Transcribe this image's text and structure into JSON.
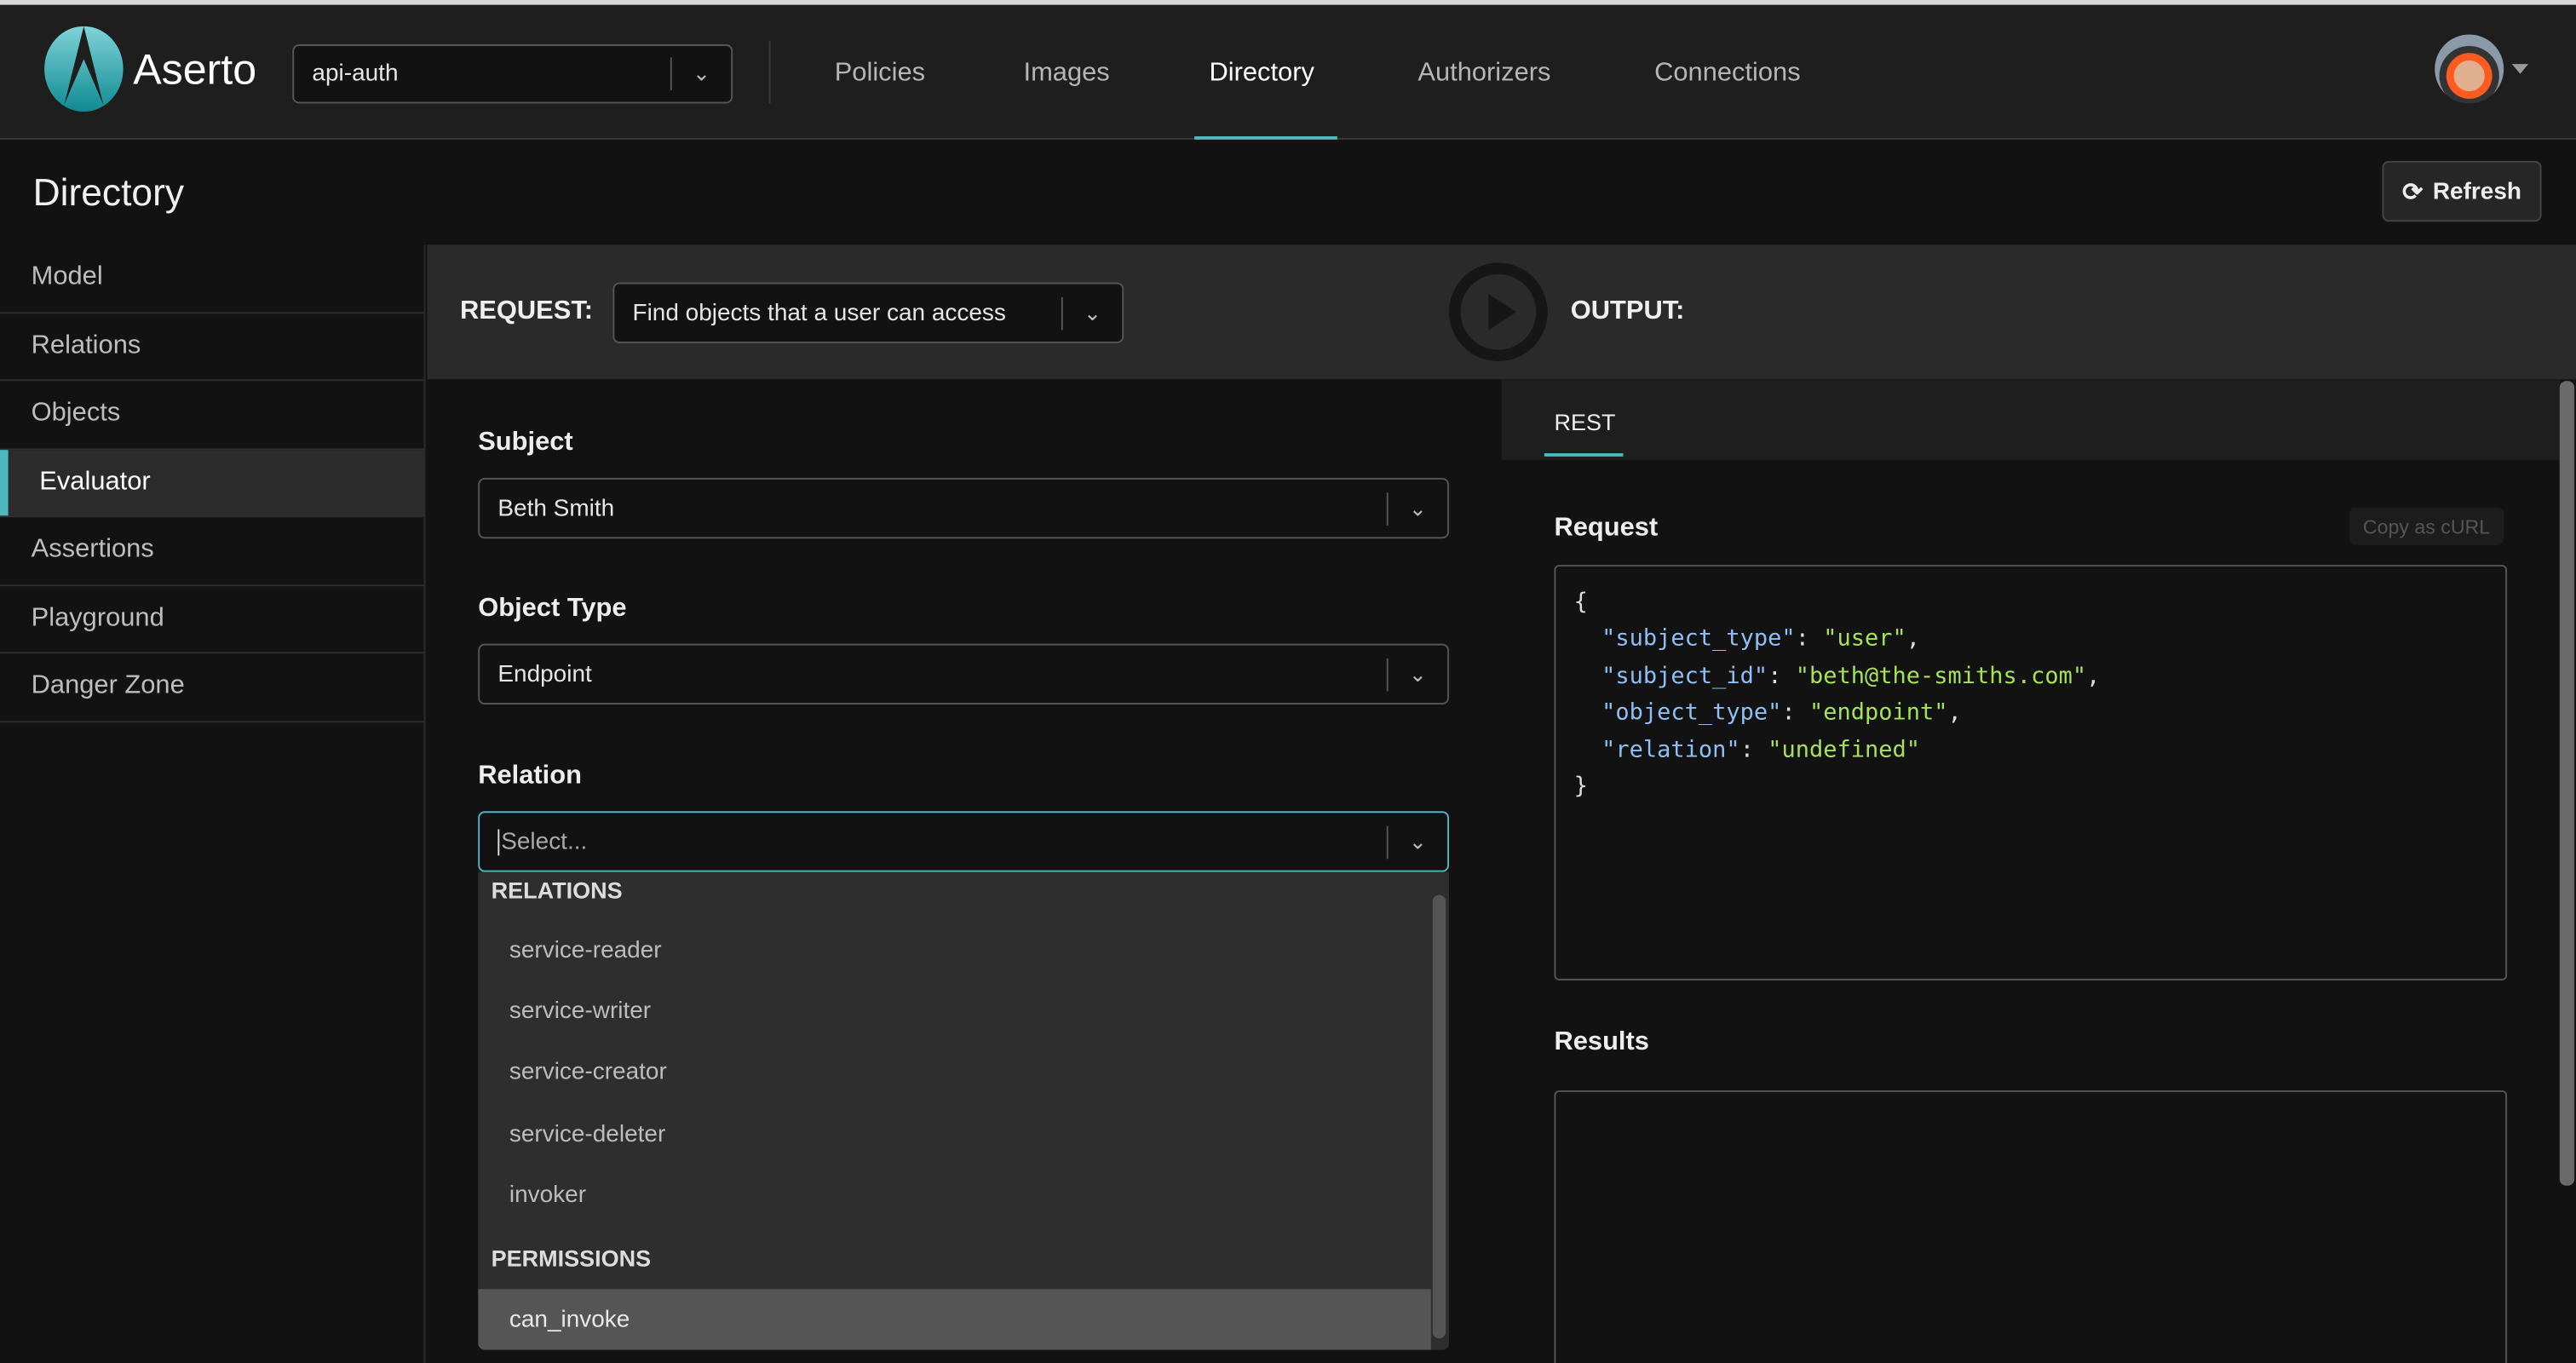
{
  "app": {
    "brand": "Aserto",
    "colors": {
      "accent": "#4fb8be",
      "json_key": "#8fbef5",
      "json_string": "#a6e15a"
    }
  },
  "header": {
    "tenant_select": {
      "value": "api-auth"
    },
    "nav": [
      {
        "label": "Policies"
      },
      {
        "label": "Images"
      },
      {
        "label": "Directory",
        "active": true
      },
      {
        "label": "Authorizers"
      },
      {
        "label": "Connections"
      }
    ],
    "avatar_icon": "user-avatar"
  },
  "page": {
    "title": "Directory",
    "refresh_label": "Refresh",
    "refresh_icon": "refresh-icon"
  },
  "sidebar": {
    "items": [
      {
        "label": "Model"
      },
      {
        "label": "Relations"
      },
      {
        "label": "Objects"
      },
      {
        "label": "Evaluator",
        "active": true
      },
      {
        "label": "Assertions"
      },
      {
        "label": "Playground"
      },
      {
        "label": "Danger Zone"
      }
    ]
  },
  "request_bar": {
    "label": "REQUEST:",
    "select_value": "Find objects that a user can access",
    "output_label": "OUTPUT:",
    "play_icon": "play-icon"
  },
  "form": {
    "subject": {
      "label": "Subject",
      "value": "Beth Smith"
    },
    "object_type": {
      "label": "Object Type",
      "value": "Endpoint"
    },
    "relation": {
      "label": "Relation",
      "placeholder": "Select..."
    },
    "dropdown": {
      "relations_header": "RELATIONS",
      "relations": [
        "service-reader",
        "service-writer",
        "service-creator",
        "service-deleter",
        "invoker"
      ],
      "permissions_header": "PERMISSIONS",
      "permissions": [
        "can_invoke"
      ]
    }
  },
  "output": {
    "tab": "REST",
    "request_label": "Request",
    "copy_label": "Copy as cURL",
    "request_json": [
      {
        "key": "subject_type",
        "value": "user"
      },
      {
        "key": "subject_id",
        "value": "beth@the-smiths.com"
      },
      {
        "key": "object_type",
        "value": "endpoint"
      },
      {
        "key": "relation",
        "value": "undefined"
      }
    ],
    "results_label": "Results"
  }
}
